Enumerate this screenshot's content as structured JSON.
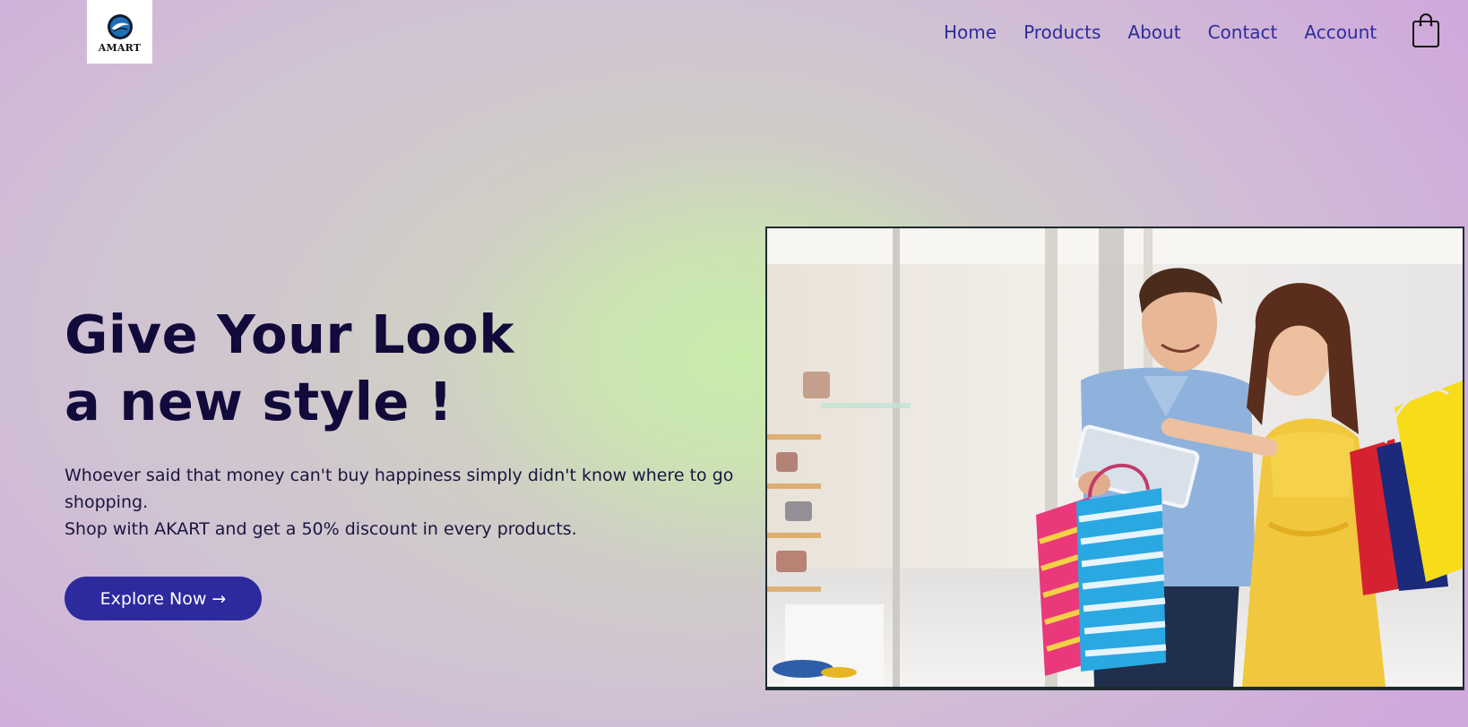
{
  "header": {
    "logo_text": "AMART",
    "nav": [
      {
        "label": "Home"
      },
      {
        "label": "Products"
      },
      {
        "label": "About"
      },
      {
        "label": "Contact"
      },
      {
        "label": "Account"
      }
    ],
    "cart_icon": "shopping-bag-icon"
  },
  "hero": {
    "headline_line1": "Give Your Look",
    "headline_line2": "a new style !",
    "description_line1": "Whoever said that money can't buy happiness simply didn't know where to go shopping.",
    "description_line2": "Shop with AKART and get a 50% discount in every products.",
    "cta_label": "Explore Now →",
    "image_subject": "couple shopping with bags and tablet"
  },
  "colors": {
    "nav_text": "#2e2c9a",
    "headline": "#110a3b",
    "cta_background": "#2d2a9e",
    "cta_text": "#ffffff"
  }
}
